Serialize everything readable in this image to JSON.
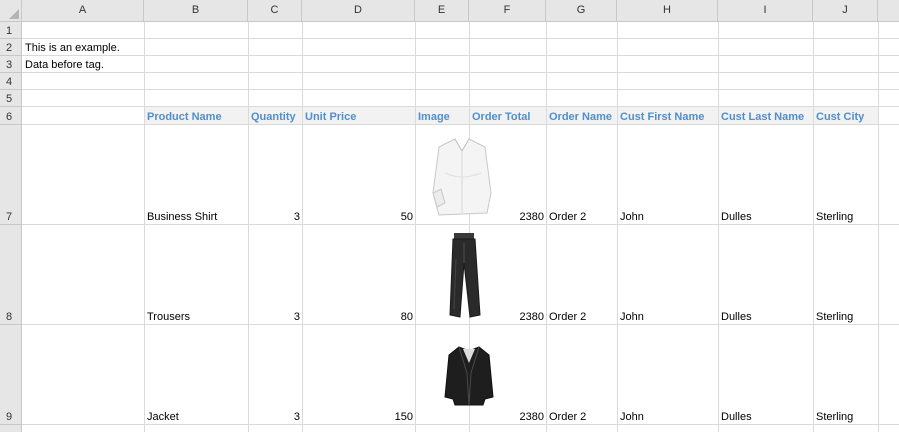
{
  "columns": [
    "A",
    "B",
    "C",
    "D",
    "E",
    "F",
    "G",
    "H",
    "I",
    "J"
  ],
  "rows": [
    "1",
    "2",
    "3",
    "4",
    "5",
    "6",
    "7",
    "8",
    "9"
  ],
  "intro": {
    "line1": "This is an example.",
    "line2": "Data before tag."
  },
  "headers": {
    "product_name": "Product Name",
    "quantity": "Quantity",
    "unit_price": "Unit Price",
    "image": "Image",
    "order_total": "Order Total",
    "order_name": "Order Name",
    "cust_first_name": "Cust First Name",
    "cust_last_name": "Cust Last Name",
    "cust_city": "Cust City"
  },
  "records": [
    {
      "product_name": "Business Shirt",
      "quantity": "3",
      "unit_price": "50",
      "image": "shirt",
      "order_total": "2380",
      "order_name": "Order 2",
      "cust_first_name": "John",
      "cust_last_name": "Dulles",
      "cust_city": "Sterling"
    },
    {
      "product_name": "Trousers",
      "quantity": "3",
      "unit_price": "80",
      "image": "trousers",
      "order_total": "2380",
      "order_name": "Order 2",
      "cust_first_name": "John",
      "cust_last_name": "Dulles",
      "cust_city": "Sterling"
    },
    {
      "product_name": "Jacket",
      "quantity": "3",
      "unit_price": "150",
      "image": "jacket",
      "order_total": "2380",
      "order_name": "Order 2",
      "cust_first_name": "John",
      "cust_last_name": "Dulles",
      "cust_city": "Sterling"
    }
  ],
  "colors": {
    "header_text": "#4f8fcf",
    "header_band": "#f2f2f2",
    "grid": "#dadada",
    "chrome": "#e6e6e6"
  }
}
